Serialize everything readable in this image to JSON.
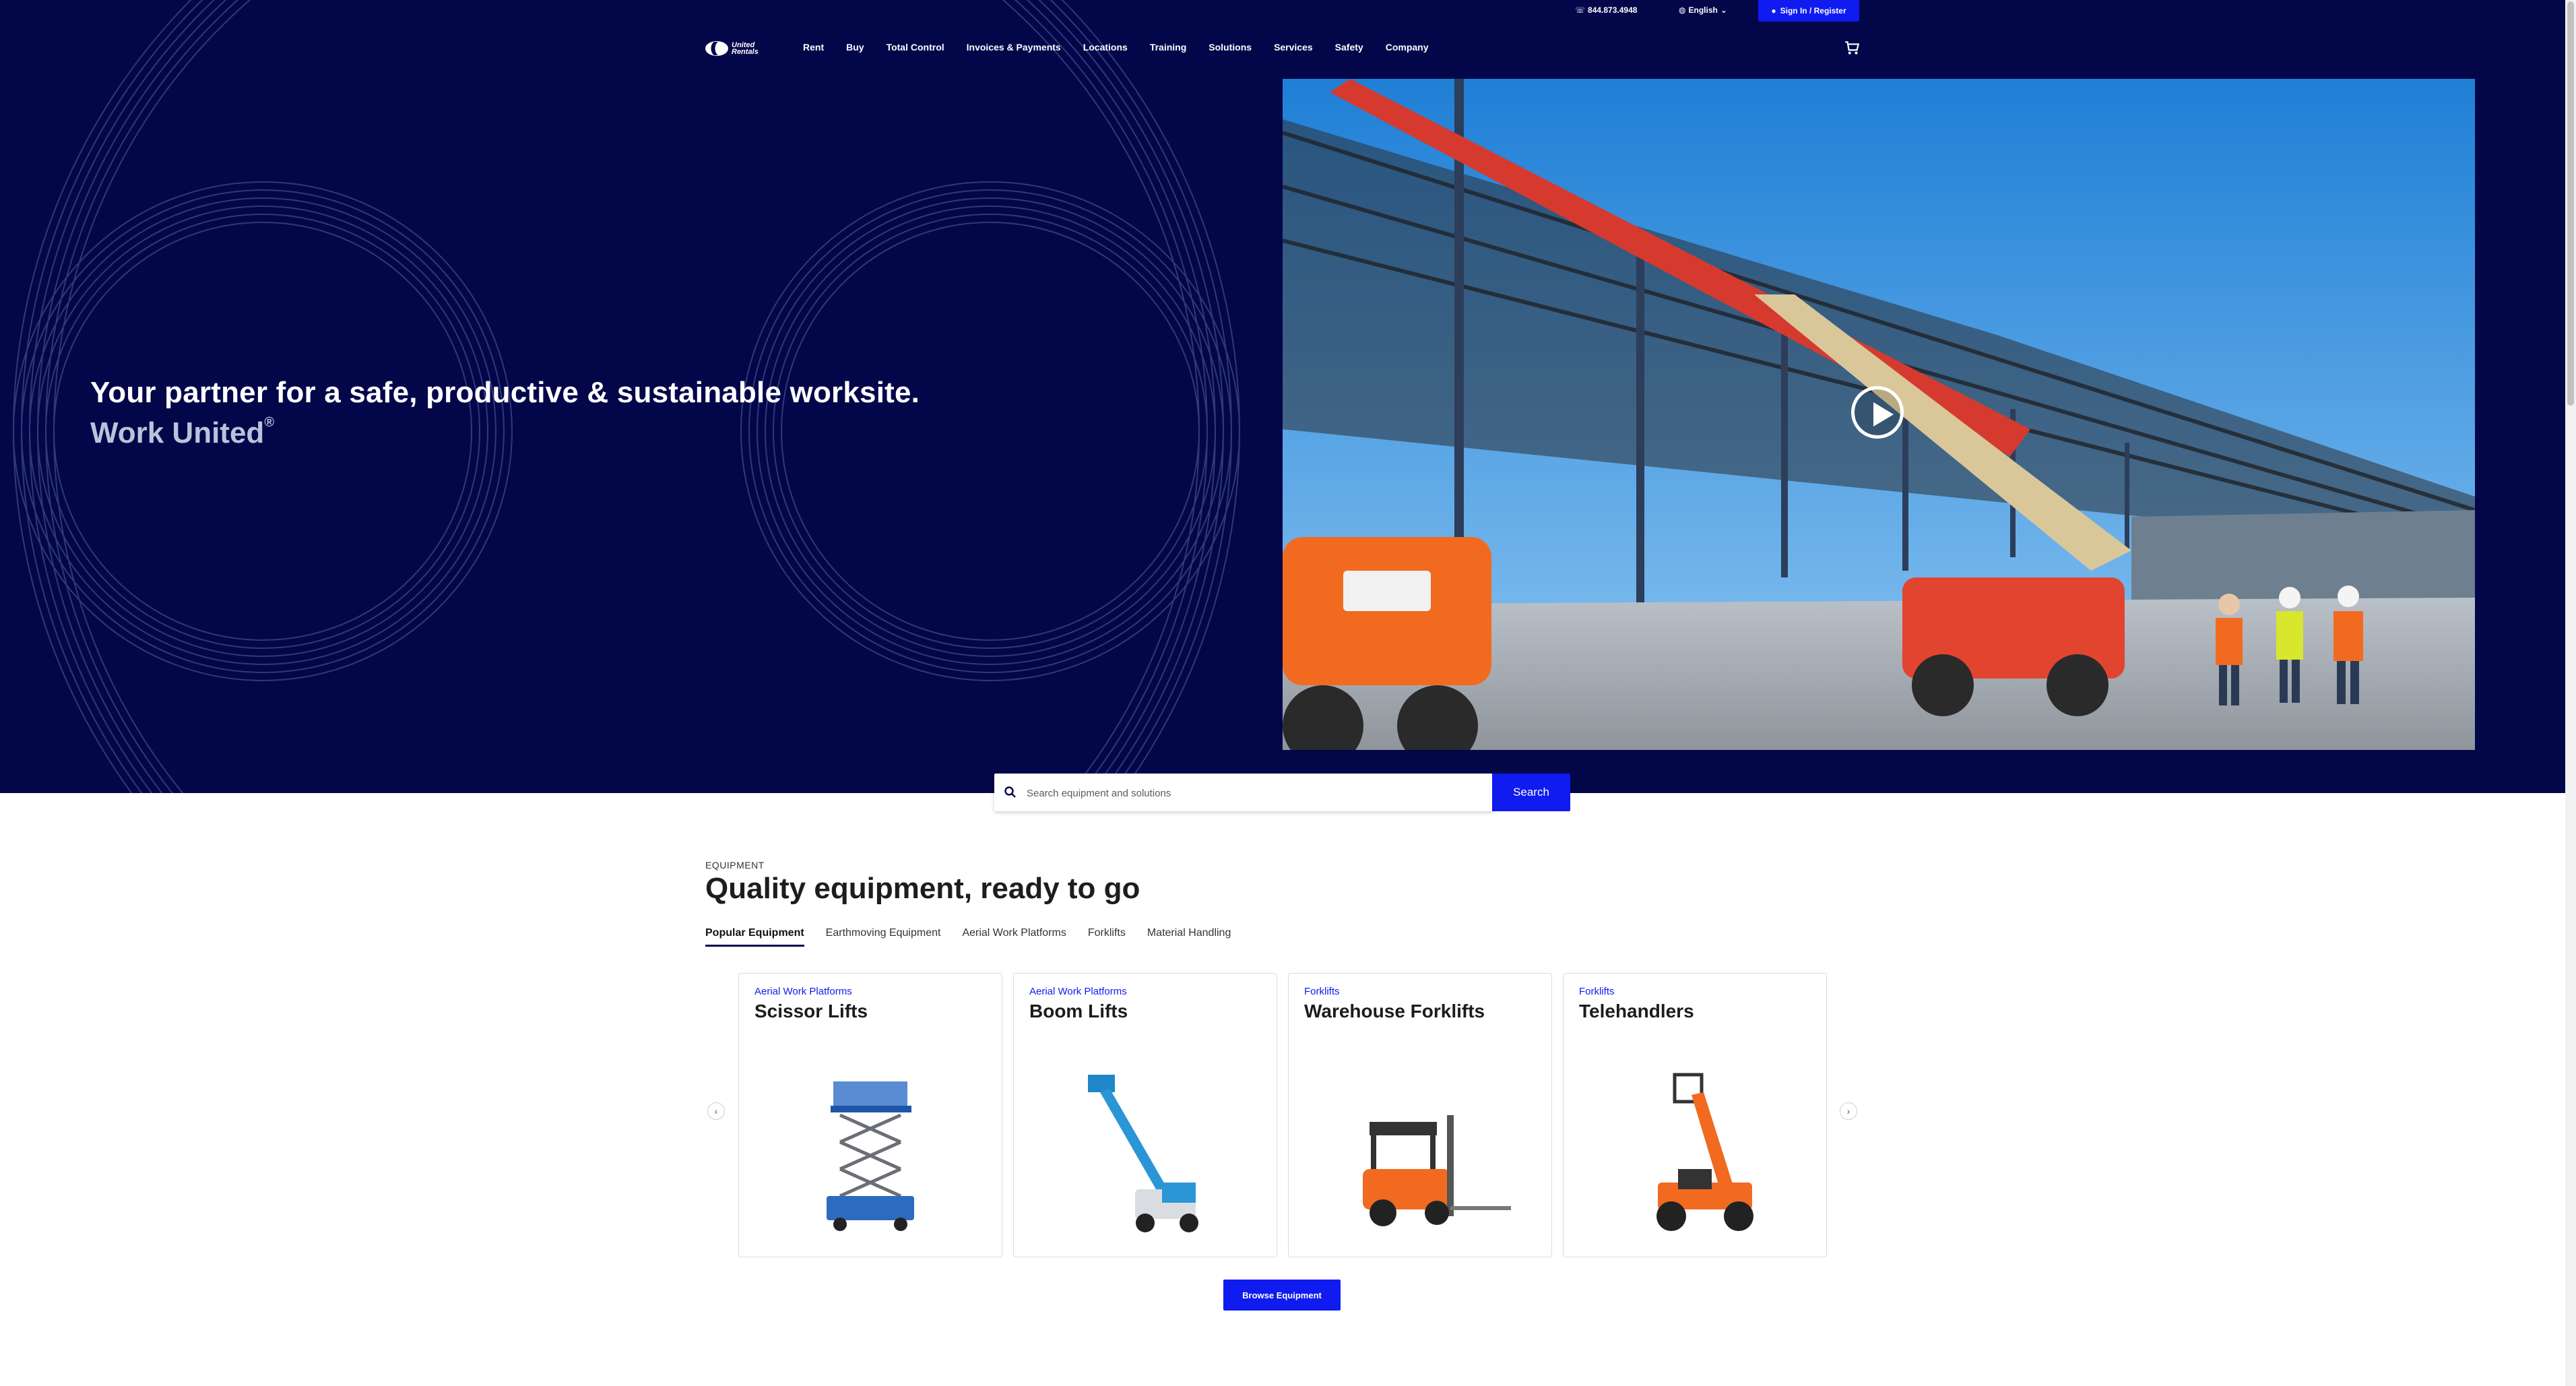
{
  "utility": {
    "phone": "844.873.4948",
    "language": "English",
    "signin_label": "Sign In / Register"
  },
  "brand": {
    "logo_line1": "United",
    "logo_line2": "Rentals"
  },
  "nav": {
    "items": [
      "Rent",
      "Buy",
      "Total Control",
      "Invoices & Payments",
      "Locations",
      "Training",
      "Solutions",
      "Services",
      "Safety",
      "Company"
    ]
  },
  "hero": {
    "headline": "Your partner for a safe, productive & sustainable worksite.",
    "subhead": "Work United",
    "subhead_mark": "®"
  },
  "search": {
    "placeholder": "Search equipment and solutions",
    "button_label": "Search"
  },
  "equipment": {
    "eyebrow": "EQUIPMENT",
    "title": "Quality equipment, ready to go",
    "tabs": [
      "Popular Equipment",
      "Earthmoving Equipment",
      "Aerial Work Platforms",
      "Forklifts",
      "Material Handling"
    ],
    "active_tab": "Popular Equipment",
    "cards": [
      {
        "category": "Aerial Work Platforms",
        "title": "Scissor Lifts",
        "image": "scissor-lift"
      },
      {
        "category": "Aerial Work Platforms",
        "title": "Boom Lifts",
        "image": "boom-lift"
      },
      {
        "category": "Forklifts",
        "title": "Warehouse Forklifts",
        "image": "warehouse-forklift"
      },
      {
        "category": "Forklifts",
        "title": "Telehandlers",
        "image": "telehandler"
      }
    ],
    "browse_label": "Browse Equipment"
  },
  "colors": {
    "hero_bg": "#03074a",
    "accent_blue": "#0f1bef",
    "card_border": "#dcdcdc"
  }
}
